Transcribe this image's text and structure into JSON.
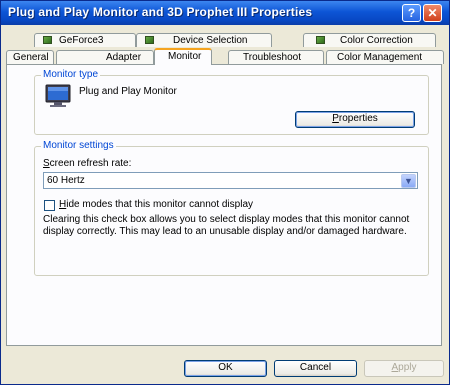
{
  "window": {
    "title": "Plug and Play Monitor and 3D Prophet III Properties",
    "help_glyph": "?",
    "close_glyph": "✕"
  },
  "tabs": {
    "top_row": [
      {
        "label": "GeForce3",
        "has_card_icon": true
      },
      {
        "label": "Device Selection",
        "has_card_icon": true
      },
      {
        "label": "Color Correction",
        "has_card_icon": true
      }
    ],
    "bottom_row": [
      {
        "label": "General"
      },
      {
        "label": "Adapter"
      },
      {
        "label": "Monitor",
        "selected": true
      },
      {
        "label": "Troubleshoot"
      },
      {
        "label": "Color Management"
      }
    ]
  },
  "monitor_type": {
    "legend": "Monitor type",
    "name": "Plug and Play Monitor",
    "properties_button": {
      "mnemonic": "P",
      "rest": "roperties"
    }
  },
  "monitor_settings": {
    "legend": "Monitor settings",
    "refresh_label": {
      "mnemonic": "S",
      "rest": "creen refresh rate:"
    },
    "refresh_value": "60 Hertz",
    "hide_modes": {
      "mnemonic": "H",
      "rest": "ide modes that this monitor cannot display",
      "checked": false
    },
    "note": "Clearing this check box allows you to select display modes that this monitor cannot display correctly. This may lead to an unusable display and/or damaged hardware."
  },
  "footer": {
    "ok": "OK",
    "cancel": "Cancel",
    "apply": {
      "mnemonic": "A",
      "rest": "pply",
      "enabled": false
    }
  },
  "colors": {
    "title_bar": "#0848c4",
    "group_legend": "#0046d5",
    "active_tab_accent": "#f5a41f"
  },
  "icons": [
    "help-icon",
    "close-icon",
    "graphics-card-icon",
    "monitor-icon",
    "chevron-down-icon"
  ]
}
